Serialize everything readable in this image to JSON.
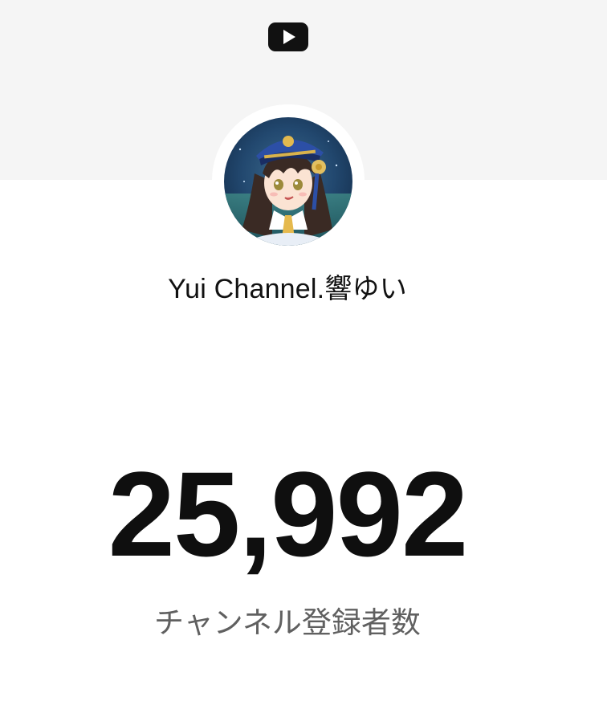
{
  "icons": {
    "app_logo": "youtube-play-icon",
    "avatar": "channel-avatar-anime-girl"
  },
  "colors": {
    "youtube_logo": "#111111",
    "banner_bg": "#f5f5f5",
    "count_text": "#0f0f0f",
    "label_text": "#606060"
  },
  "channel": {
    "name": "Yui Channel.響ゆい"
  },
  "stats": {
    "subscriber_count": "25,992",
    "subscriber_label": "チャンネル登録者数"
  }
}
